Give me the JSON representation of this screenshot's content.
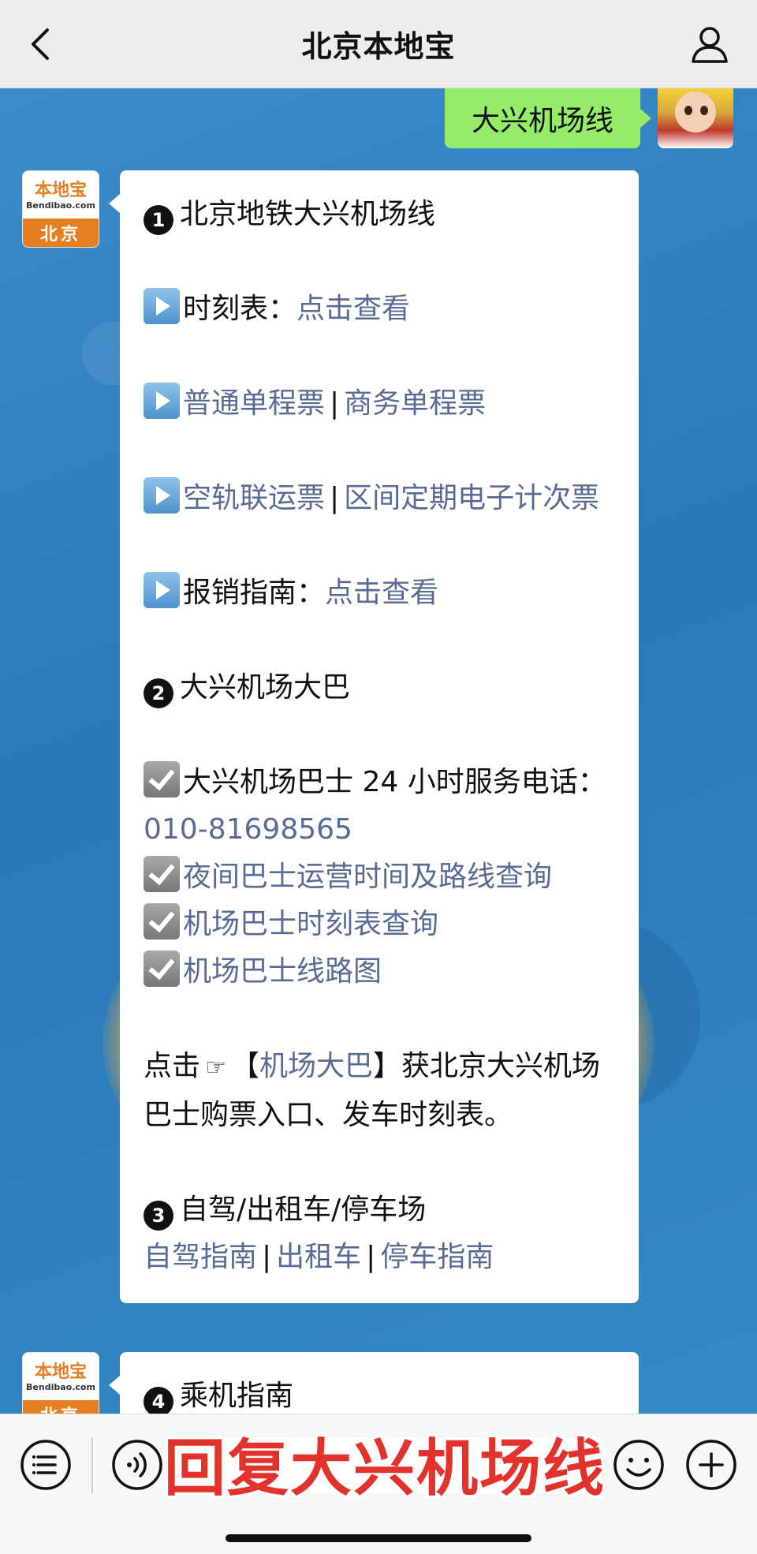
{
  "header": {
    "title": "北京本地宝"
  },
  "user_message": {
    "text": "大兴机场线"
  },
  "bot_avatar": {
    "line1": "本地宝",
    "line2": "Bendibao.com",
    "city": "北京"
  },
  "message1": {
    "s1_num": "1",
    "s1_title": "北京地铁大兴机场线",
    "timetable_label": "时刻表：",
    "timetable_link": "点击查看",
    "ticket_link_1": "普通单程票",
    "ticket_sep_1": "|",
    "ticket_link_2": "商务单程票",
    "ticket_link_3": "空轨联运票",
    "ticket_sep_2": "|",
    "ticket_link_4": "区间定期电子计次票",
    "reimburse_label": "报销指南：",
    "reimburse_link": "点击查看",
    "s2_num": "2",
    "s2_title": "大兴机场大巴",
    "phone_label": "大兴机场巴士 24 小时服务电话：",
    "phone_number": "010-81698565",
    "night_bus_link": "夜间巴士运营时间及路线查询",
    "bus_timetable_link": "机场巴士时刻表查询",
    "bus_map_link": "机场巴士线路图",
    "click_prefix": "点击",
    "hand_symbol": "☞",
    "bracket_open": "【",
    "airport_bus_link": "机场大巴",
    "bracket_close": "】",
    "click_suffix": "获北京大兴机场巴士购票入口、发车时刻表。",
    "s3_num": "3",
    "s3_title": "自驾/出租车/停车场",
    "drive_link": "自驾指南",
    "drive_sep_1": "|",
    "taxi_link": "出租车",
    "drive_sep_2": "|",
    "parking_link": "停车指南"
  },
  "message2": {
    "s4_num": "4",
    "s4_title": "乘机指南"
  },
  "bottombar": {
    "overlay_text": "回复大兴机场线"
  },
  "colors": {
    "link": "#576b95",
    "user_bubble": "#95ec69",
    "brand_orange": "#e67e22",
    "overlay_red": "#e3322b"
  },
  "icons": [
    "back-arrow-icon",
    "profile-icon",
    "play-icon",
    "checkbox-icon",
    "menu-icon",
    "voice-icon",
    "emoji-icon",
    "plus-icon"
  ]
}
